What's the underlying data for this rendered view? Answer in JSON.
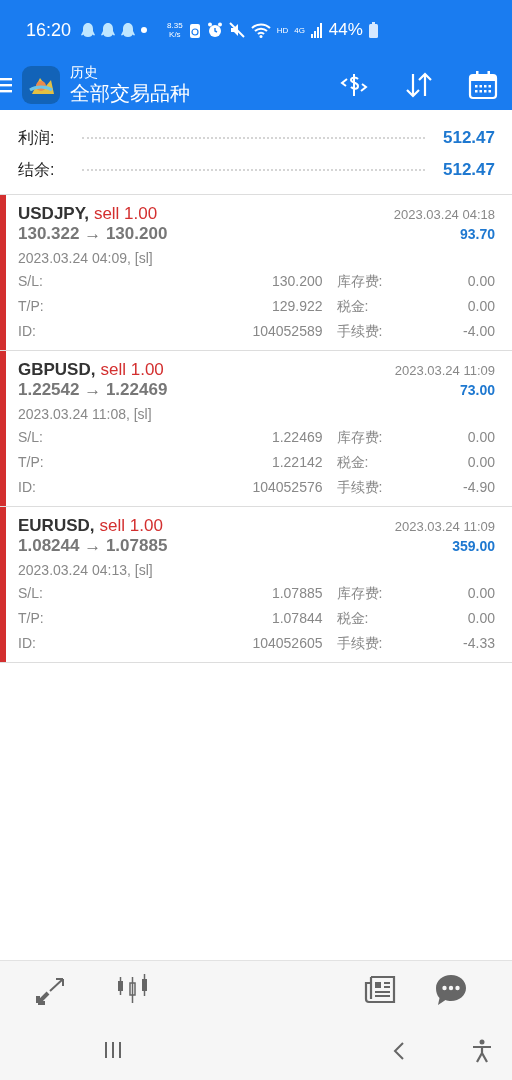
{
  "status_bar": {
    "time": "16:20",
    "speed_value": "8.35",
    "speed_unit": "K/s",
    "hd": "HD",
    "network": "4G",
    "battery": "44%"
  },
  "header": {
    "subtitle": "历史",
    "title": "全部交易品种"
  },
  "summary": [
    {
      "label": "利润:",
      "value": "512.47"
    },
    {
      "label": "结余:",
      "value": "512.47"
    }
  ],
  "trades": [
    {
      "symbol": "USDJPY,",
      "side": "sell 1.00",
      "color": "#d32f2f",
      "prices": "130.322 → 130.200",
      "close_time": "2023.03.24 04:18",
      "profit": "93.70",
      "open_time": "2023.03.24 04:09, [sl]",
      "details": [
        {
          "label": "S/L:",
          "value": "130.200",
          "label2": "库存费:",
          "value2": "0.00"
        },
        {
          "label": "T/P:",
          "value": "129.922",
          "label2": "税金:",
          "value2": "0.00"
        },
        {
          "label": "ID:",
          "value": "104052589",
          "label2": "手续费:",
          "value2": "-4.00"
        }
      ]
    },
    {
      "symbol": "GBPUSD,",
      "side": "sell 1.00",
      "color": "#d32f2f",
      "prices": "1.22542 → 1.22469",
      "close_time": "2023.03.24 11:09",
      "profit": "73.00",
      "open_time": "2023.03.24 11:08, [sl]",
      "details": [
        {
          "label": "S/L:",
          "value": "1.22469",
          "label2": "库存费:",
          "value2": "0.00"
        },
        {
          "label": "T/P:",
          "value": "1.22142",
          "label2": "税金:",
          "value2": "0.00"
        },
        {
          "label": "ID:",
          "value": "104052576",
          "label2": "手续费:",
          "value2": "-4.90"
        }
      ]
    },
    {
      "symbol": "EURUSD,",
      "side": "sell 1.00",
      "color": "#d32f2f",
      "prices": "1.08244 → 1.07885",
      "close_time": "2023.03.24 11:09",
      "profit": "359.00",
      "open_time": "2023.03.24 04:13, [sl]",
      "details": [
        {
          "label": "S/L:",
          "value": "1.07885",
          "label2": "库存费:",
          "value2": "0.00"
        },
        {
          "label": "T/P:",
          "value": "1.07844",
          "label2": "税金:",
          "value2": "0.00"
        },
        {
          "label": "ID:",
          "value": "104052605",
          "label2": "手续费:",
          "value2": "-4.33"
        }
      ]
    }
  ]
}
